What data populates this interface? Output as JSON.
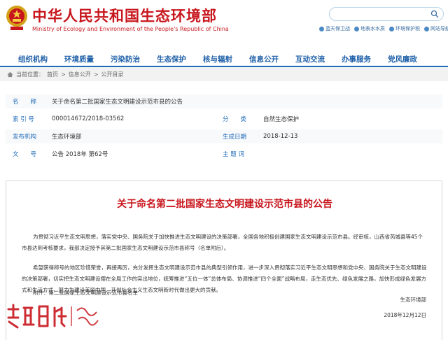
{
  "header": {
    "title": "中华人民共和国生态环境部",
    "subtitle": "Ministry of Ecology and Environment of the People's Republic of China",
    "quick_links": [
      "蓝天保卫战",
      "地表水水质",
      "环境保护税",
      "网站导航"
    ]
  },
  "nav": {
    "items": [
      "组织机构",
      "环境质量",
      "污染防治",
      "生态保护",
      "核与辐射",
      "信息公开",
      "互动交流",
      "办事服务",
      "党风廉政"
    ]
  },
  "breadcrumb": {
    "prefix": "当前位置：",
    "items": [
      "首页",
      "信息公开",
      "公开目录"
    ],
    "separator": ">"
  },
  "info": {
    "name_label": "名　　称",
    "name_value": "关于命名第二批国家生态文明建设示范市县的公告",
    "index_label": "索 引 号",
    "index_value": "000014672/2018-03562",
    "category_label": "分　　类",
    "category_value": "自然生态保护",
    "publisher_label": "发布机构",
    "publisher_value": "生态环境部",
    "date_label": "生成日期",
    "date_value": "2018-12-13",
    "doc_label": "文　　号",
    "doc_value": "公告 2018年 第62号",
    "topic_label": "主 题 词",
    "topic_value": ""
  },
  "article": {
    "title": "关于命名第二批国家生态文明建设示范市县的公告",
    "para1": "为贯彻习近平生态文明思想，落实党中央、国务院关于加快推进生态文明建设的决策部署，全国各地积极创建国家生态文明建设示范市县。经审核，山西省芮城县等45个市县达到考核要求，我部决定授予其第二批国家生态文明建设示范市县称号（名单附后）。",
    "para2": "希望获得称号的地区珍惜荣誉，再接再厉，充分发挥生态文明建设示范市县的典型引领作用，进一步深入贯彻落实习近平生态文明思想和党中央、国务院关于生态文明建设的决策部署，切实把生态文明建设摆在全局工作的突出地位，统筹推进“五位一体”总体布局、协调推进“四个全面”战略布局，走生态优先、绿色发展之路，加快形成绿色发展方式和生活方式，努力为建设美丽中国、开创社会主义生态文明新时代做出更大的贡献。",
    "attachment": "附件：第二批国家生态文明建设示范市县名单",
    "signature": "生态环境部",
    "date": "2018年12月12日"
  },
  "watermark": {
    "text": "吉林日报"
  },
  "colors": {
    "brand_red": "#c8161d",
    "nav_blue": "#1e5fa8",
    "label_blue": "#1e6bb8"
  }
}
